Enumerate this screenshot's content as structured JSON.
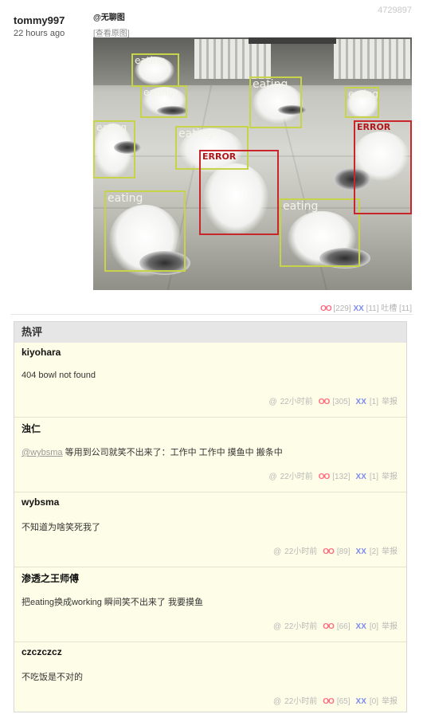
{
  "post": {
    "id": "4729897",
    "author": "tommy997",
    "time": "22 hours ago",
    "title": "@无聊图",
    "view_original": "[查看原图]",
    "image_labels": [
      "eating",
      "eating",
      "eating",
      "eating",
      "eating",
      "eating",
      "eating",
      "eating",
      "ERROR",
      "ERROR"
    ],
    "votes": {
      "oo_label": "OO",
      "oo_count": "[229]",
      "xx_label": "XX",
      "xx_count": "[11]",
      "tucao": "吐槽 [11]"
    }
  },
  "hot": {
    "title": "热评",
    "comments": [
      {
        "author": "kiyohara",
        "text": "404 bowl not found",
        "mention": "",
        "time": "22小时前",
        "oo": "OO",
        "oo_count": "[305]",
        "xx": "XX",
        "xx_count": "[1]",
        "report": "举报"
      },
      {
        "author": "浊仁",
        "mention": "@wybsma",
        "text": " 等用到公司就笑不出来了：工作中 工作中 摸鱼中 搬条中",
        "time": "22小时前",
        "oo": "OO",
        "oo_count": "[132]",
        "xx": "XX",
        "xx_count": "[1]",
        "report": "举报"
      },
      {
        "author": "wybsma",
        "text": "不知道为啥笑死我了",
        "mention": "",
        "time": "22小时前",
        "oo": "OO",
        "oo_count": "[89]",
        "xx": "XX",
        "xx_count": "[2]",
        "report": "举报"
      },
      {
        "author": "渗透之王师傅",
        "text": "把eating换成working 瞬间笑不出来了 我要摸鱼",
        "mention": "",
        "time": "22小时前",
        "oo": "OO",
        "oo_count": "[66]",
        "xx": "XX",
        "xx_count": "[0]",
        "report": "举报"
      },
      {
        "author": "czczczcz",
        "text": "不吃饭是不对的",
        "mention": "",
        "time": "22小时前",
        "oo": "OO",
        "oo_count": "[65]",
        "xx": "XX",
        "xx_count": "[0]",
        "report": "举报"
      }
    ]
  },
  "colors": {
    "oo": "#ff6a7f",
    "xx": "#7d8bf0",
    "box": "#c7d44a",
    "error_box": "#c8262a",
    "panel_bg": "#fefee8"
  }
}
